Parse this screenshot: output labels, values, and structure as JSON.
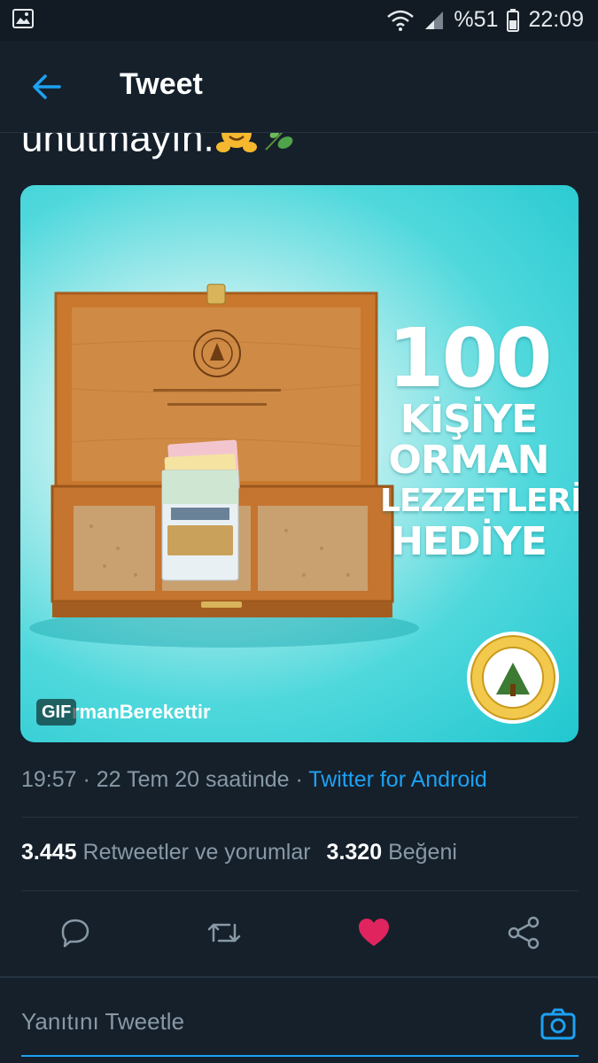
{
  "status_bar": {
    "battery": "%51",
    "time": "22:09"
  },
  "header": {
    "title": "Tweet"
  },
  "tweet": {
    "text_tail": "unutmayın."
  },
  "media": {
    "headline": {
      "number": "100",
      "line1": "KİŞİYE",
      "line2": "ORMAN",
      "line3": "LEZZETLERİ",
      "line4": "HEDİYE"
    },
    "hashtag": "rmanBerekettir",
    "gif_label": "GIF"
  },
  "meta": {
    "time": "19:57",
    "separator1": " · ",
    "date": "22 Tem 20 saatinde",
    "separator2": " · ",
    "source": "Twitter for Android"
  },
  "stats": {
    "retweets_count": "3.445",
    "retweets_label": "Retweetler ve yorumlar",
    "likes_count": "3.320",
    "likes_label": "Beğeni"
  },
  "actions": {
    "reply_icon": "reply-icon",
    "retweet_icon": "retweet-icon",
    "like_icon": "heart-icon",
    "share_icon": "share-icon",
    "like_color": "#e0245e"
  },
  "reply": {
    "placeholder": "Yanıtını Tweetle"
  },
  "colors": {
    "background": "#15202b",
    "accent": "#1da1f2",
    "muted_text": "#8899a6",
    "divider": "#253341"
  }
}
